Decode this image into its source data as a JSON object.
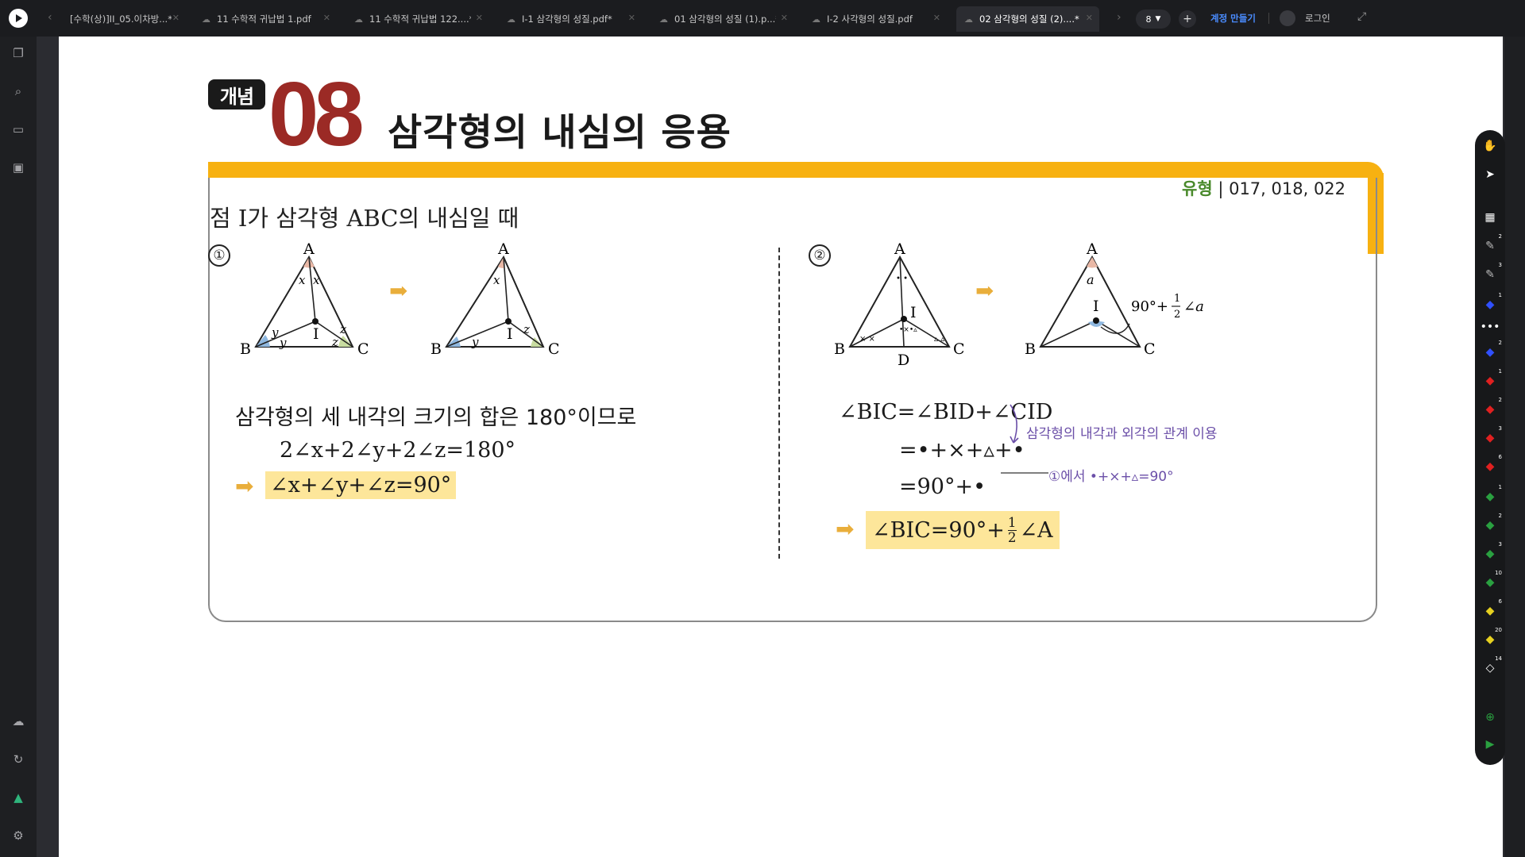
{
  "tabs": [
    {
      "title": "[수학(상)]II_05.이차방...*"
    },
    {
      "title": "11 수학적 귀납법 1.pdf"
    },
    {
      "title": "11 수학적 귀납법 122....*"
    },
    {
      "title": "I-1 삼각형의 성질.pdf*"
    },
    {
      "title": "01 삼각형의 성질 (1).p...*"
    },
    {
      "title": "I-2 사각형의 성질.pdf"
    },
    {
      "title": "02 삼각형의 성질 (2)....*",
      "active": true
    }
  ],
  "tab_count": "8",
  "header": {
    "signup": "계정 만들기",
    "login": "로그인"
  },
  "slide": {
    "badge": "개념",
    "number": "08",
    "title": "삼각형의 내심의 응용",
    "type_label": "유형",
    "type_refs": "| 017, 018, 022",
    "intro": "점 I가 삼각형 ABC의 내심일 때",
    "part1": {
      "num": "①",
      "text1": "삼각형의 세 내각의 크기의 합은 180°이므로",
      "eq1": "2∠x+2∠y+2∠z=180°",
      "result": "∠x+∠y+∠z=90°"
    },
    "part2": {
      "num": "②",
      "eq1": "∠BIC=∠BID+∠CID",
      "eq2": "=•+×+▵+•",
      "eq3": "=90°+•",
      "note1": "삼각형의 내각과 외각의 관계 이용",
      "note2": "①에서  •+×+▵=90°",
      "result_left": "∠BIC=90°+",
      "result_num": "1",
      "result_den": "2",
      "result_right": "∠A",
      "diagram_label_left": "90°+",
      "diagram_label_right": "∠a"
    },
    "diagram_labels": {
      "A": "A",
      "B": "B",
      "C": "C",
      "I": "I",
      "D": "D",
      "x": "x",
      "y": "y",
      "z": "z",
      "a": "a"
    }
  },
  "tool_badges": [
    "2",
    "3",
    "1",
    "2",
    "1",
    "2",
    "3",
    "6",
    "1",
    "2",
    "3",
    "10",
    "6",
    "20",
    "14"
  ]
}
